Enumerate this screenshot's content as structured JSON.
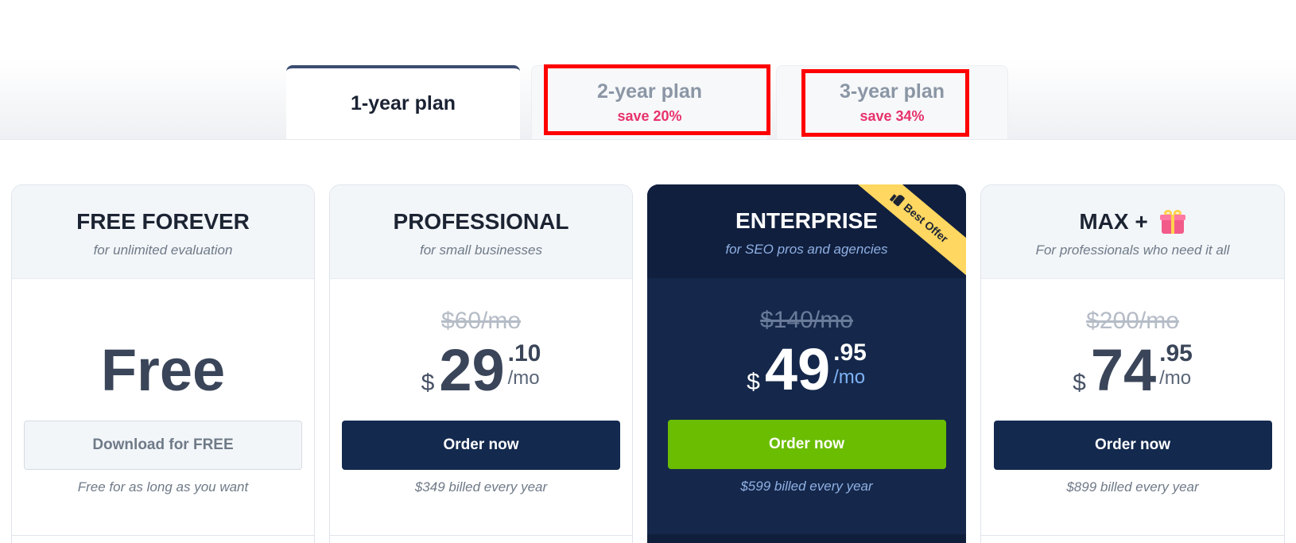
{
  "tabs": [
    {
      "title": "1-year plan",
      "save": ""
    },
    {
      "title": "2-year plan",
      "save": "save 20%"
    },
    {
      "title": "3-year plan",
      "save": "save 34%"
    }
  ],
  "plans": [
    {
      "name": "FREE FOREVER",
      "subtitle": "for unlimited evaluation",
      "price_text": "Free",
      "button": "Download for FREE",
      "billing": "Free for as long as you want"
    },
    {
      "name": "PROFESSIONAL",
      "subtitle": "for small businesses",
      "old_price": "$60/mo",
      "currency": "$",
      "amount": "29",
      "cents": ".10",
      "per": "/mo",
      "button": "Order now",
      "billing": "$349 billed every year"
    },
    {
      "name": "ENTERPRISE",
      "subtitle": "for SEO pros and agencies",
      "ribbon": "Best Offer",
      "old_price": "$140/mo",
      "currency": "$",
      "amount": "49",
      "cents": ".95",
      "per": "/mo",
      "button": "Order now",
      "billing": "$599 billed every year"
    },
    {
      "name": "MAX +",
      "subtitle": "For professionals who need it all",
      "old_price": "$200/mo",
      "currency": "$",
      "amount": "74",
      "cents": ".95",
      "per": "/mo",
      "button": "Order now",
      "billing": "$899 billed every year"
    }
  ],
  "colors": {
    "accent_dark": "#13294e",
    "accent_green": "#6abd00",
    "save_pink": "#e8326b",
    "ribbon_yellow": "#ffd761",
    "highlight_red": "#ff0000"
  },
  "icons": {
    "ribbon": "thumbs-up-icon",
    "max_plan": "gift-icon"
  }
}
